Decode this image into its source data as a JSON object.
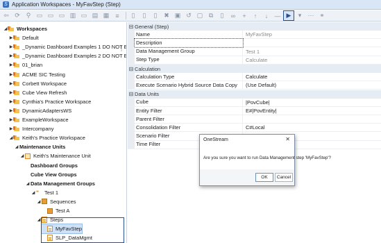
{
  "window": {
    "title": "Application Workspaces - MyFavStep (Step)"
  },
  "toolbar": {
    "left_icons": [
      "back-arrow-icon",
      "refresh-icon",
      "filter-icon",
      "folder-icon",
      "folder-icon",
      "folder-icon",
      "chart-icon",
      "folder-icon",
      "table-icon",
      "grid-icon",
      "list-icon"
    ],
    "right_icons": [
      "document-icon",
      "document-icon",
      "document-icon",
      "delete-icon",
      "properties-icon",
      "undo-icon",
      "save-icon",
      "copy-icon",
      "document-icon",
      "binoculars-icon",
      "add-icon",
      "up-arrow-icon",
      "down-arrow-icon",
      "minus-icon",
      "run-icon",
      "select-icon",
      "more-icon",
      "link-icon"
    ]
  },
  "tree": [
    {
      "label": "Workspaces",
      "bold": true,
      "tri": "◢",
      "icon": "folder",
      "indent": 0
    },
    {
      "label": "Default",
      "tri": "▶",
      "icon": "folder",
      "indent": 1
    },
    {
      "label": "_Dynamic Dashboard Examples 1 DO NOT EDI",
      "tri": "▶",
      "icon": "folder",
      "indent": 1
    },
    {
      "label": "_Dynamic Dashboard Examples 2 DO NOT EDI",
      "tri": "▶",
      "icon": "folder",
      "indent": 1
    },
    {
      "label": "01_brian",
      "tri": "▶",
      "icon": "folder",
      "indent": 1
    },
    {
      "label": "ACME SIC Testing",
      "tri": "▶",
      "icon": "folder",
      "indent": 1
    },
    {
      "label": "Corbett Workspace",
      "tri": "▶",
      "icon": "folder",
      "indent": 1
    },
    {
      "label": "Cube View Refresh",
      "tri": "▶",
      "icon": "folder",
      "indent": 1
    },
    {
      "label": "Cynthia's Practice Workspace",
      "tri": "▶",
      "icon": "folder",
      "indent": 1
    },
    {
      "label": "DynamicAdaptersWS",
      "tri": "▶",
      "icon": "folder",
      "indent": 1
    },
    {
      "label": "ExampleWorkspace",
      "tri": "▶",
      "icon": "folder",
      "indent": 1
    },
    {
      "label": "Intercompany",
      "tri": "▶",
      "icon": "folder",
      "indent": 1
    },
    {
      "label": "Keith's Practice Workspace",
      "tri": "◢",
      "icon": "folder",
      "indent": 1
    },
    {
      "label": "Maintenance Units",
      "bold": true,
      "tri": "◢",
      "icon": "none",
      "indent": 2
    },
    {
      "label": "Keith's Maintenance Unit",
      "tri": "◢",
      "icon": "square",
      "indent": 3
    },
    {
      "label": "Dashboard Groups",
      "bold": true,
      "tri": "",
      "icon": "none",
      "indent": 4
    },
    {
      "label": "Cube View Groups",
      "bold": true,
      "tri": "",
      "icon": "none",
      "indent": 4
    },
    {
      "label": "Data Management Groups",
      "bold": true,
      "tri": "◢",
      "icon": "none",
      "indent": 4
    },
    {
      "label": "Test 1",
      "tri": "◢",
      "icon": "dots",
      "indent": 5
    },
    {
      "label": "Sequences",
      "tri": "◢",
      "icon": "grid",
      "indent": 6
    },
    {
      "label": "Test A",
      "tri": "",
      "icon": "grid",
      "indent": 7
    },
    {
      "label": "Steps",
      "tri": "◢",
      "icon": "step",
      "indent": 6
    },
    {
      "label": "MyFavStep",
      "tri": "",
      "icon": "step",
      "indent": 7,
      "selected": true
    },
    {
      "label": "SLP_DataMgmt",
      "tri": "",
      "icon": "step",
      "indent": 7
    }
  ],
  "properties": {
    "general_header": "General (Step)",
    "general": [
      {
        "key": "Name",
        "value": "MyFavStep",
        "gray": true
      },
      {
        "key": "Description",
        "value": ""
      },
      {
        "key": "Data Management Group",
        "value": "Test 1",
        "gray": true
      },
      {
        "key": "Step Type",
        "value": "Calculate",
        "gray": true
      }
    ],
    "calculation_header": "Calculation",
    "calculation": [
      {
        "key": "Calculation Type",
        "value": "Calculate"
      },
      {
        "key": "Execute Scenario Hybrid Source Data Copy",
        "value": "(Use Default)"
      }
    ],
    "data_units_header": "Data Units",
    "data_units": [
      {
        "key": "Cube",
        "value": "|PovCube|"
      },
      {
        "key": "Entity Filter",
        "value": "E#|PovEntity|"
      },
      {
        "key": "Parent Filter",
        "value": ""
      },
      {
        "key": "Consolidation Filter",
        "value": "C#Local"
      },
      {
        "key": "Scenario Filter",
        "value": ""
      },
      {
        "key": "Time Filter",
        "value": ""
      }
    ]
  },
  "dialog": {
    "title": "OneStream",
    "message": "Are you sure you want to run Data Management step 'MyFavStep'?",
    "ok_label": "OK",
    "cancel_label": "Cancel",
    "close_glyph": "✕"
  },
  "colors": {
    "accent": "#2a4f8f",
    "folder": "#f1c253",
    "pin": "#e8702a",
    "header_bg": "#e6ecf4"
  }
}
